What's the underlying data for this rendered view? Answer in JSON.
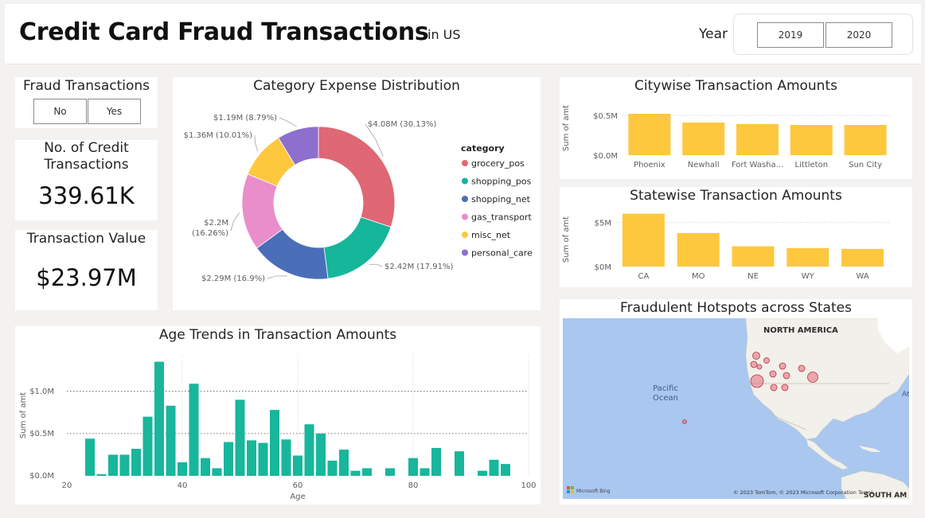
{
  "header": {
    "title": "Credit Card Fraud Transactions",
    "subtitle": "in US",
    "year_label": "Year",
    "year_options": [
      "2019",
      "2020"
    ]
  },
  "fraud_filter": {
    "title": "Fraud Transactions",
    "options": [
      "No",
      "Yes"
    ]
  },
  "kpi_count": {
    "title": "No. of Credit Transactions",
    "value": "339.61K"
  },
  "kpi_value": {
    "title": "Transaction Value",
    "value": "$23.97M"
  },
  "donut": {
    "title": "Category Expense Distribution",
    "legend_title": "category"
  },
  "age": {
    "title": "Age Trends in Transaction Amounts"
  },
  "city": {
    "title": "Citywise Transaction Amounts"
  },
  "state": {
    "title": "Statewise Transaction Amounts"
  },
  "map": {
    "title": "Fraudulent Hotspots across States",
    "continent_label": "NORTH AMERICA",
    "ocean_label_1": "Pacific",
    "ocean_label_2": "Ocean",
    "south_label": "SOUTH AM",
    "edge_label": "At",
    "attribution": "© 2023 TomTom, © 2023 Microsoft Corporation Terms",
    "logo_text": "Microsoft Bing",
    "water_color": "#a9c7ef",
    "land_color": "#f2f0ea",
    "bubble_color": "#e26a79"
  },
  "colors": {
    "teal": "#18b69b",
    "yellow": "#fdc83e",
    "grocery": "#e06774",
    "shopping_pos": "#16b69b",
    "shopping_net": "#4a6fb8",
    "gas": "#ea8ecb",
    "misc": "#fdc83e",
    "personal": "#8d6fce"
  },
  "chart_data": [
    {
      "type": "pie",
      "title": "Category Expense Distribution",
      "legend_title": "category",
      "categories": [
        "grocery_pos",
        "shopping_pos",
        "shopping_net",
        "gas_transport",
        "misc_net",
        "personal_care"
      ],
      "values": [
        4.08,
        2.42,
        2.29,
        2.2,
        1.36,
        1.19
      ],
      "percents": [
        30.13,
        17.91,
        16.9,
        16.26,
        10.01,
        8.79
      ],
      "labels": [
        "$4.08M (30.13%)",
        "$2.42M (17.91%)",
        "$2.29M (16.9%)",
        "$2.2M (16.26%)",
        "$1.36M (10.01%)",
        "$1.19M (8.79%)"
      ],
      "legend": "right"
    },
    {
      "type": "bar",
      "title": "Age Trends in Transaction Amounts",
      "xlabel": "Age",
      "ylabel": "Sum of amt",
      "xlim": [
        20,
        100
      ],
      "ylim": [
        0,
        1.45
      ],
      "x_ticks": [
        20,
        40,
        60,
        80,
        100
      ],
      "y_ticks": [
        0,
        0.5,
        1.0
      ],
      "y_tick_labels": [
        "$0.0M",
        "$0.5M",
        "$1.0M"
      ],
      "x": [
        24,
        26,
        28,
        30,
        32,
        34,
        36,
        38,
        40,
        42,
        44,
        46,
        48,
        50,
        52,
        54,
        56,
        58,
        60,
        62,
        64,
        66,
        68,
        70,
        72,
        74,
        76,
        78,
        80,
        82,
        84,
        86,
        88,
        90,
        92,
        94,
        96
      ],
      "values": [
        0.44,
        0.02,
        0.25,
        0.25,
        0.32,
        0.7,
        1.35,
        0.83,
        0.16,
        1.09,
        0.21,
        0.09,
        0.4,
        0.9,
        0.42,
        0.39,
        0.78,
        0.43,
        0.24,
        0.61,
        0.5,
        0.18,
        0.31,
        0.06,
        0.09,
        0.0,
        0.09,
        0.0,
        0.21,
        0.09,
        0.33,
        0.0,
        0.29,
        0.0,
        0.06,
        0.19,
        0.14
      ]
    },
    {
      "type": "bar",
      "title": "Citywise Transaction Amounts",
      "ylabel": "Sum of amt",
      "categories": [
        "Phoenix",
        "Newhall",
        "Fort Washa...",
        "Littleton",
        "Sun City"
      ],
      "values": [
        0.52,
        0.41,
        0.39,
        0.38,
        0.38
      ],
      "ylim": [
        0,
        0.6
      ],
      "y_tick_labels": [
        "$0.0M",
        "$0.5M"
      ]
    },
    {
      "type": "bar",
      "title": "Statewise Transaction Amounts",
      "ylabel": "Sum of amt",
      "categories": [
        "CA",
        "MO",
        "NE",
        "WY",
        "WA"
      ],
      "values": [
        6.0,
        3.8,
        2.3,
        2.1,
        2.0
      ],
      "ylim": [
        0,
        6.5
      ],
      "y_tick_labels": [
        "$0M",
        "$5M"
      ]
    }
  ]
}
